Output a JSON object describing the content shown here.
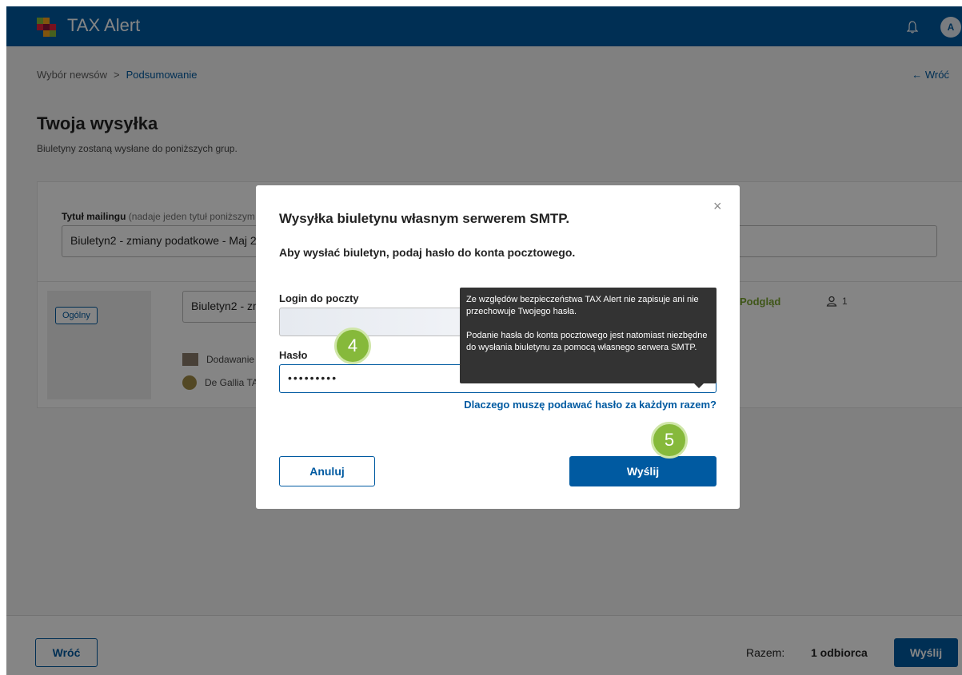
{
  "header": {
    "app_name": "TAX Alert",
    "avatar_initials": "A"
  },
  "breadcrumb": {
    "step1": "Wybór newsów",
    "separator": ">",
    "step2": "Podsumowanie"
  },
  "back_link": "← Wróć",
  "page": {
    "title": "Twoja wysyłka",
    "subtitle": "Biuletyny zostaną wysłane do poniższych grup."
  },
  "card": {
    "label": "Tytuł mailingu",
    "label_note": "(nadaje jeden tytuł poniższym b",
    "title_value": "Biuletyn2 - zmiany podatkowe - Maj 202",
    "group_badge": "Ogólny",
    "row_title": "Biuletyn2 - zm",
    "news": [
      "Dodawanie",
      "De Gallia TA"
    ],
    "preview": "Podgląd",
    "recipient_count": "1"
  },
  "footer": {
    "back_label": "Wróć",
    "total_label": "Razem:",
    "total_value": "1 odbiorca",
    "send_label": "Wyślij"
  },
  "modal": {
    "close": "×",
    "title": "Wysyłka biuletynu własnym serwerem SMTP.",
    "subtitle": "Aby wysłać biuletyn, podaj hasło do konta pocztowego.",
    "login_label": "Login do poczty",
    "login_value": "",
    "password_label": "Hasło",
    "password_value": "•••••••••",
    "why_link": "Dlaczego muszę podawać hasło za każdym razem?",
    "cancel_label": "Anuluj",
    "send_label": "Wyślij"
  },
  "tooltip": {
    "line1": "Ze względów bezpieczeństwa TAX Alert nie zapisuje ani nie przechowuje Twojego hasła.",
    "line2": "Podanie hasła do konta pocztowego jest natomiast niezbędne do wysłania biuletynu za pomocą własnego serwera SMTP."
  },
  "step_badges": {
    "step4": "4",
    "step5": "5"
  },
  "colors": {
    "brand": "#005aa1",
    "accent_green": "#86b93b",
    "preview_green": "#79a52e"
  }
}
